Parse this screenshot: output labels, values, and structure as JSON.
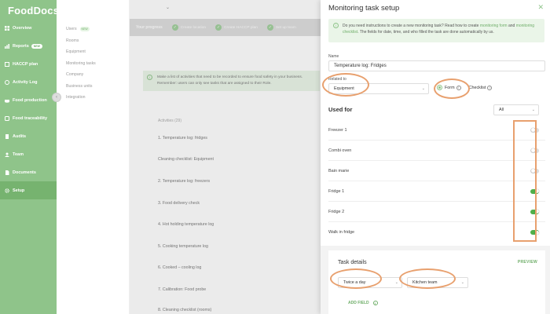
{
  "sidebar": {
    "logo": "FoodDocs",
    "items": [
      {
        "label": "Overview",
        "icon": "grid-icon"
      },
      {
        "label": "Reports",
        "icon": "chart-icon",
        "badge": "NEW"
      },
      {
        "label": "HACCP plan",
        "icon": "clipboard-icon"
      },
      {
        "label": "Activity Log",
        "icon": "activity-icon"
      },
      {
        "label": "Food production",
        "icon": "pot-icon"
      },
      {
        "label": "Food traceability",
        "icon": "trace-icon"
      },
      {
        "label": "Audits",
        "icon": "audit-icon"
      },
      {
        "label": "Team",
        "icon": "team-icon"
      },
      {
        "label": "Documents",
        "icon": "document-icon"
      },
      {
        "label": "Setup",
        "icon": "gear-icon",
        "active": true
      }
    ]
  },
  "subnav": {
    "items": [
      {
        "label": "Users",
        "badge": "NEW"
      },
      {
        "label": "Rooms"
      },
      {
        "label": "Equipment"
      },
      {
        "label": "Monitoring tasks"
      },
      {
        "label": "Company"
      },
      {
        "label": "Business units"
      },
      {
        "label": "Integration"
      }
    ]
  },
  "main": {
    "progress": {
      "label": "Your progress",
      "steps": [
        "Create location",
        "Create HACCP plan",
        "Set up team"
      ]
    },
    "banner": "Make a list of activities that need to be recorded to ensure food safety in your business. Remember: users can only see tasks that are assigned to their Role.",
    "activities_head": "Activities (29)",
    "activities": [
      "1. Temperature log: fridges",
      "Cleaning checklist: Equipment",
      "2. Temperature log: freezers",
      "3. Food delivery check",
      "4. Hot holding temperature log",
      "5. Cooking temperature log",
      "6. Cooked – cooling log",
      "7. Calibration: Food probe",
      "8. Cleaning checklist (rooms)"
    ]
  },
  "panel": {
    "title": "Monitoring task setup",
    "info": {
      "text1": "Do you need instructions to create a new monitoring task? Read how to create ",
      "link1": "monitoring form",
      "text2": " and ",
      "link2": "monitoring checklist",
      "text3": ". The fields for date, time, and who filled the task are done automatically by us."
    },
    "name_label": "Name",
    "name_value": "Temperature log: Fridges",
    "related_label": "Related to",
    "related_value": "Equipment",
    "type_options": {
      "form": "Form",
      "checklist": "Checklist",
      "selected": "Form"
    },
    "used_for_title": "Used for",
    "filter_value": "All",
    "used_for_items": [
      {
        "label": "Freezer 1",
        "on": false
      },
      {
        "label": "Combi oven",
        "on": false
      },
      {
        "label": "Bain marie",
        "on": false
      },
      {
        "label": "Fridge 1",
        "on": true
      },
      {
        "label": "Fridge 2",
        "on": true
      },
      {
        "label": "Walk in fridge",
        "on": true
      }
    ],
    "task_details": {
      "title": "Task details",
      "preview": "PREVIEW",
      "frequency": "Twice a day",
      "team": "Kitchen team",
      "add_field": "ADD FIELD"
    }
  },
  "colors": {
    "brand_green": "#8fc48a",
    "toggle_on": "#4fb04a",
    "highlight_orange": "#e8a06e"
  }
}
